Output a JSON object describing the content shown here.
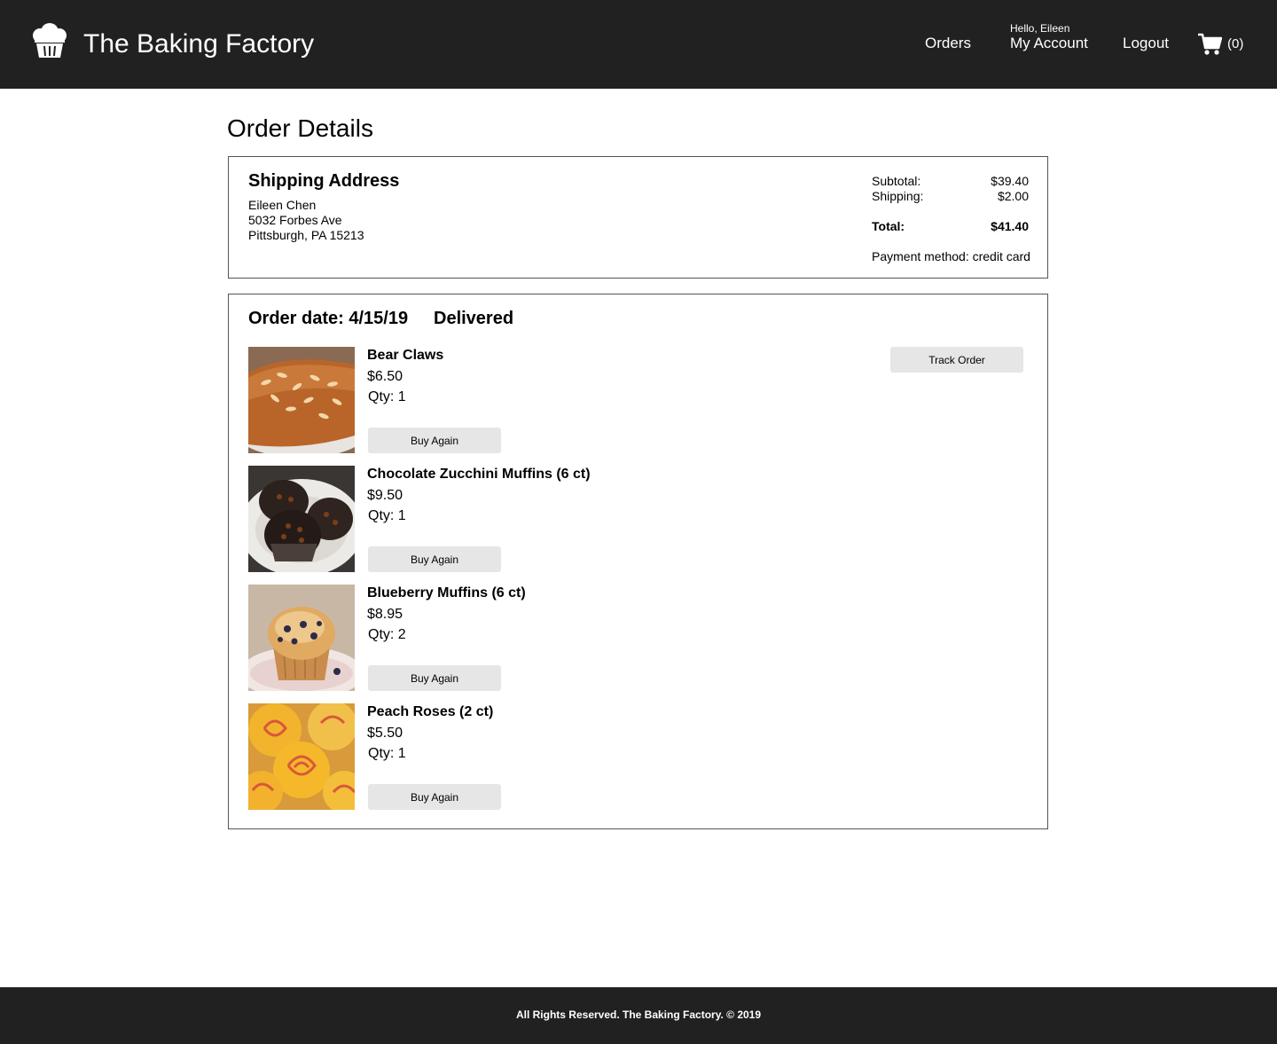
{
  "header": {
    "brand": "The Baking Factory",
    "logo_icon": "cupcake-icon",
    "nav": {
      "orders": "Orders",
      "greeting": "Hello, Eileen",
      "account": "My Account",
      "logout": "Logout"
    },
    "cart": {
      "icon": "cart-icon",
      "count": "(0)"
    }
  },
  "page": {
    "title": "Order Details"
  },
  "shipping": {
    "title": "Shipping Address",
    "name": "Eileen Chen",
    "street": "5032 Forbes Ave",
    "city": "Pittsburgh, PA 15213"
  },
  "summary": {
    "subtotal_label": "Subtotal:",
    "subtotal_value": "$39.40",
    "shipping_label": "Shipping:",
    "shipping_value": "$2.00",
    "total_label": "Total:",
    "total_value": "$41.40",
    "payment": "Payment method: credit card"
  },
  "order": {
    "date": "Order date: 4/15/19",
    "status": "Delivered",
    "track_label": "Track Order",
    "items": [
      {
        "name": "Bear Claws",
        "price": "$6.50",
        "qty": "Qty: 1",
        "buy_label": "Buy Again",
        "image": "bear-claws-photo"
      },
      {
        "name": "Chocolate Zucchini Muffins (6 ct)",
        "price": "$9.50",
        "qty": "Qty: 1",
        "buy_label": "Buy Again",
        "image": "chocolate-muffins-photo"
      },
      {
        "name": "Blueberry Muffins (6 ct)",
        "price": "$8.95",
        "qty": "Qty: 2",
        "buy_label": "Buy Again",
        "image": "blueberry-muffin-photo"
      },
      {
        "name": "Peach Roses (2 ct)",
        "price": "$5.50",
        "qty": "Qty: 1",
        "buy_label": "Buy Again",
        "image": "peach-roses-photo"
      }
    ]
  },
  "footer": {
    "text": "All Rights Reserved. The Baking Factory. © 2019"
  },
  "colors": {
    "header_bg": "#212121",
    "button_bg": "#e6e6e6",
    "border": "#555555"
  }
}
